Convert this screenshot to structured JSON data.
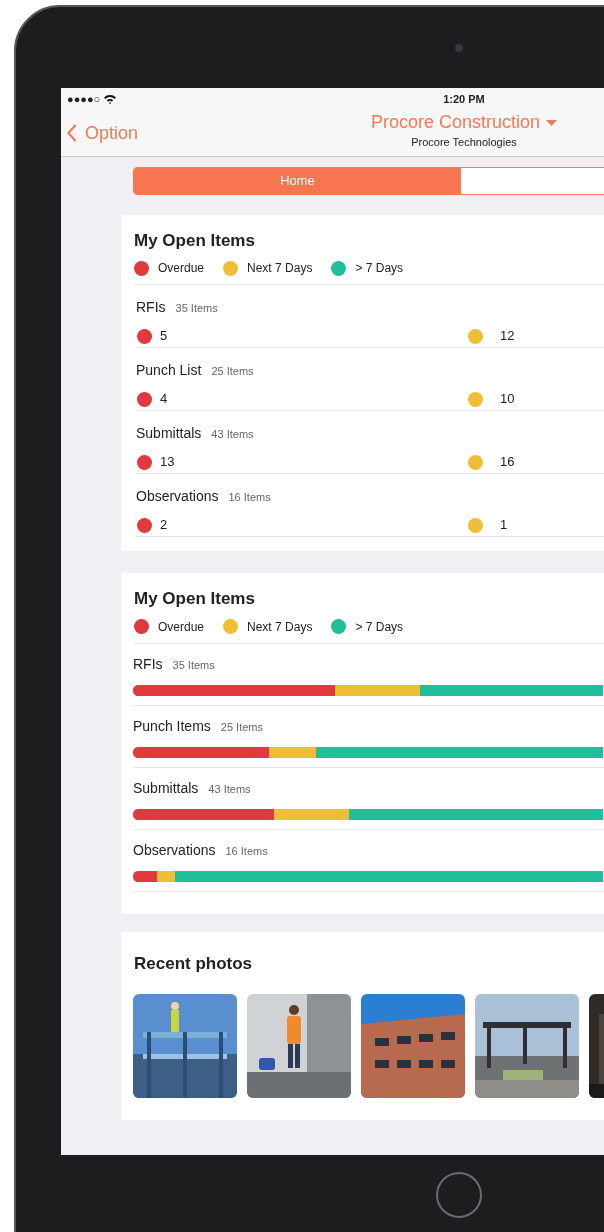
{
  "status_bar": {
    "signal": "●●●●○",
    "time": "1:20 PM"
  },
  "nav": {
    "back": "Option",
    "title": "Procore Construction",
    "subtitle": "Procore Technologies"
  },
  "tabs": [
    {
      "label": "Home",
      "selected": true
    }
  ],
  "summary_card": {
    "title": "My Open Items",
    "legend": [
      {
        "label": "Overdue",
        "color": "#e0393e"
      },
      {
        "label": "Next 7 Days",
        "color": "#eebf35"
      },
      {
        "label": "> 7 Days",
        "color": "#1fbf99"
      }
    ],
    "rows": [
      {
        "name": "RFIs",
        "count": "35 Items",
        "overdue": "5",
        "next_7_days": "12"
      },
      {
        "name": "Punch List",
        "count": "25 Items",
        "overdue": "4",
        "next_7_days": "10"
      },
      {
        "name": "Submittals",
        "count": "43 Items",
        "overdue": "13",
        "next_7_days": "16"
      },
      {
        "name": "Observations",
        "count": "16 Items",
        "overdue": "2",
        "next_7_days": "1"
      }
    ]
  },
  "bars_card": {
    "title": "My Open Items",
    "legend": [
      {
        "label": "Overdue",
        "color": "#e0393e"
      },
      {
        "label": "Next 7 Days",
        "color": "#eebf35"
      },
      {
        "label": "> 7 Days",
        "color": "#1fbf99"
      }
    ],
    "rows": [
      {
        "name": "RFIs",
        "count": "35 Items",
        "segments": [
          {
            "color": "#e0393e",
            "level": 0.43
          },
          {
            "color": "#eebf35",
            "level": 0.61
          }
        ]
      },
      {
        "name": "Punch Items",
        "count": "25 Items",
        "segments": [
          {
            "color": "#e0393e",
            "level": 0.29
          },
          {
            "color": "#eebf35",
            "level": 0.39
          }
        ]
      },
      {
        "name": "Submittals",
        "count": "43 Items",
        "segments": [
          {
            "color": "#e0393e",
            "level": 0.3
          },
          {
            "color": "#eebf35",
            "level": 0.46
          }
        ]
      },
      {
        "name": "Observations",
        "count": "16 Items",
        "segments": [
          {
            "color": "#e0393e",
            "level": 0.05
          },
          {
            "color": "#eebf35",
            "level": 0.09
          }
        ]
      }
    ]
  },
  "photos": {
    "title": "Recent photos"
  }
}
